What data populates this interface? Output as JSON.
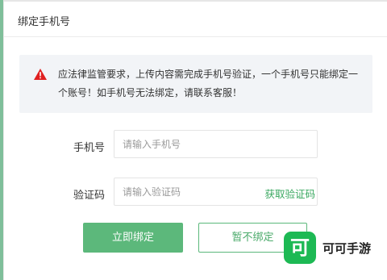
{
  "dialog": {
    "title": "绑定手机号"
  },
  "notice": {
    "icon": "warning-triangle-icon",
    "accent_color": "#e02020",
    "text": "应法律监管要求，上传内容需完成手机号验证，一个手机号只能绑定一个账号！如手机号无法绑定，请联系客服！"
  },
  "form": {
    "phone": {
      "label": "手机号",
      "placeholder": "请输入手机号",
      "value": ""
    },
    "code": {
      "label": "验证码",
      "placeholder": "请输入验证码",
      "value": "",
      "get_code_label": "获取验证码"
    }
  },
  "buttons": {
    "bind_now": "立即绑定",
    "skip": "暂不绑定"
  },
  "watermark": {
    "logo_char": "可",
    "text": "可可手游"
  },
  "colors": {
    "brand": "#5cb87b",
    "warning": "#e02020"
  }
}
